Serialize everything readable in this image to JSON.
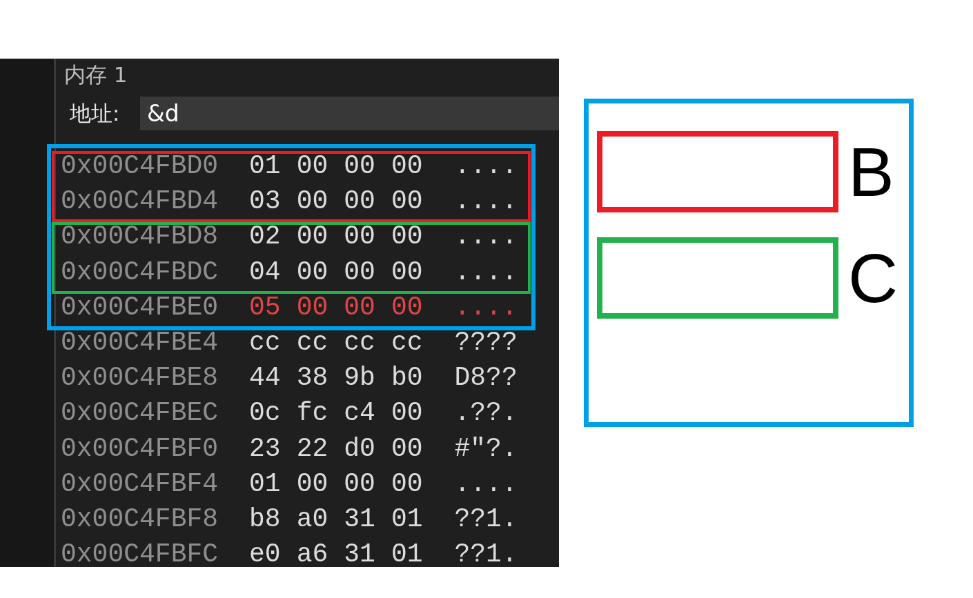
{
  "memory_window": {
    "title": "内存 1",
    "address_label": "地址:",
    "address_value": "&d",
    "rows": [
      {
        "address": "0x00C4FBD0",
        "bytes": [
          "01",
          "00",
          "00",
          "00"
        ],
        "ascii": "....",
        "changed": false
      },
      {
        "address": "0x00C4FBD4",
        "bytes": [
          "03",
          "00",
          "00",
          "00"
        ],
        "ascii": "....",
        "changed": false
      },
      {
        "address": "0x00C4FBD8",
        "bytes": [
          "02",
          "00",
          "00",
          "00"
        ],
        "ascii": "....",
        "changed": false
      },
      {
        "address": "0x00C4FBDC",
        "bytes": [
          "04",
          "00",
          "00",
          "00"
        ],
        "ascii": "....",
        "changed": false
      },
      {
        "address": "0x00C4FBE0",
        "bytes": [
          "05",
          "00",
          "00",
          "00"
        ],
        "ascii": "....",
        "changed": true
      },
      {
        "address": "0x00C4FBE4",
        "bytes": [
          "cc",
          "cc",
          "cc",
          "cc"
        ],
        "ascii": "????",
        "changed": false
      },
      {
        "address": "0x00C4FBE8",
        "bytes": [
          "44",
          "38",
          "9b",
          "b0"
        ],
        "ascii": "D8??",
        "changed": false
      },
      {
        "address": "0x00C4FBEC",
        "bytes": [
          "0c",
          "fc",
          "c4",
          "00"
        ],
        "ascii": ".??.",
        "changed": false
      },
      {
        "address": "0x00C4FBF0",
        "bytes": [
          "23",
          "22",
          "d0",
          "00"
        ],
        "ascii": "#\"?.",
        "changed": false
      },
      {
        "address": "0x00C4FBF4",
        "bytes": [
          "01",
          "00",
          "00",
          "00"
        ],
        "ascii": "....",
        "changed": false
      },
      {
        "address": "0x00C4FBF8",
        "bytes": [
          "b8",
          "a0",
          "31",
          "01"
        ],
        "ascii": "??1.",
        "changed": false
      },
      {
        "address": "0x00C4FBFC",
        "bytes": [
          "e0",
          "a6",
          "31",
          "01"
        ],
        "ascii": "??1.",
        "changed": false
      }
    ]
  },
  "overlay_frames": [
    {
      "color": "#00a0e6"
    },
    {
      "color": "#ed1c24"
    },
    {
      "color": "#22b14c"
    }
  ],
  "legend": {
    "color": "#00a0e6",
    "items": [
      {
        "label": "B",
        "color": "#ed1c24"
      },
      {
        "label": "C",
        "color": "#22b14c"
      }
    ]
  }
}
